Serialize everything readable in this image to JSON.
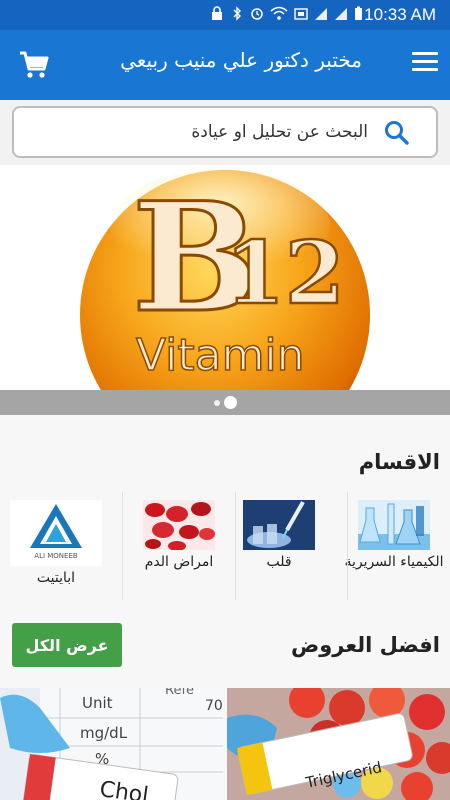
{
  "status_bar": {
    "time": "10:33 AM",
    "icons": [
      "lock-icon",
      "bluetooth-icon",
      "alarm-icon",
      "wifi-icon",
      "cast-icon",
      "signal-icon",
      "signal-icon",
      "battery-icon"
    ]
  },
  "app_bar": {
    "title": "مختبر دكتور علي منيب ربيعي",
    "menu_icon": "menu-icon",
    "cart_icon": "cart-icon"
  },
  "search": {
    "placeholder": "البحث عن تحليل او عيادة"
  },
  "banner": {
    "big_text": "B",
    "number_text": "12",
    "word_text": "Vitamin",
    "slide_count": 2,
    "active_slide": 2
  },
  "categories": {
    "title": "الاقسام",
    "items": [
      {
        "label": "الكيمياء السريرية",
        "icon": "chemistry-flasks-image"
      },
      {
        "label": "قلب",
        "icon": "pipette-image"
      },
      {
        "label": "امراض الدم",
        "icon": "blood-cells-image"
      },
      {
        "label": "ابايتيت",
        "icon": "lab-logo-image",
        "logo_text": "ALI MONEEB"
      }
    ]
  },
  "offers": {
    "title": "افضل العروض",
    "view_all": "عرض الكل",
    "items": [
      {
        "image": "cholesterol-test-image",
        "words": [
          "Unit",
          "mg/dL",
          "%",
          "Chol",
          "Refe",
          "70"
        ]
      },
      {
        "image": "triglyceride-test-image",
        "words": [
          "Triglycerid"
        ]
      }
    ]
  },
  "colors": {
    "status_bar": "#1565c0",
    "app_bar": "#1976d2",
    "accent_green": "#43a047",
    "search_icon": "#1976d2",
    "vitamin_orange": "#f39200"
  }
}
